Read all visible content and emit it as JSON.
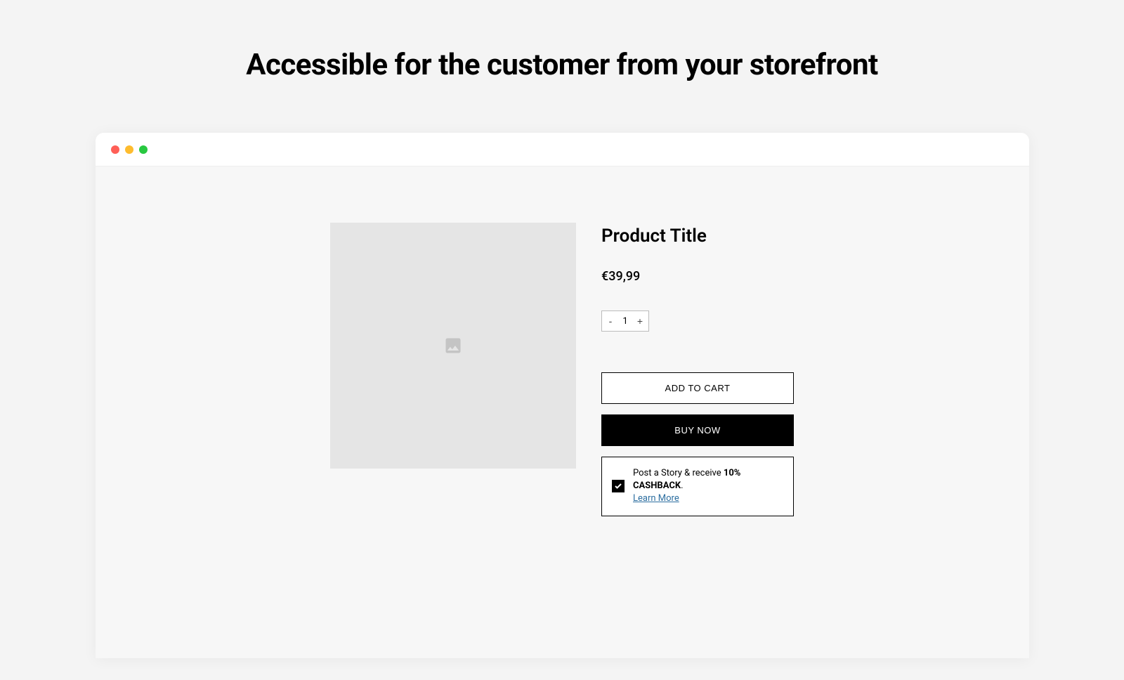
{
  "header": {
    "title": "Accessible for the customer from your storefront"
  },
  "product": {
    "title": "Product Title",
    "price": "€39,99",
    "quantity": "1",
    "add_to_cart_label": "ADD TO CART",
    "buy_now_label": "BUY NOW"
  },
  "quantity_controls": {
    "decrement": "-",
    "increment": "+"
  },
  "cashback": {
    "prefix": "Post a Story & receive ",
    "emphasis": "10% CASHBACK",
    "suffix": ".",
    "learn_more": "Learn More"
  }
}
